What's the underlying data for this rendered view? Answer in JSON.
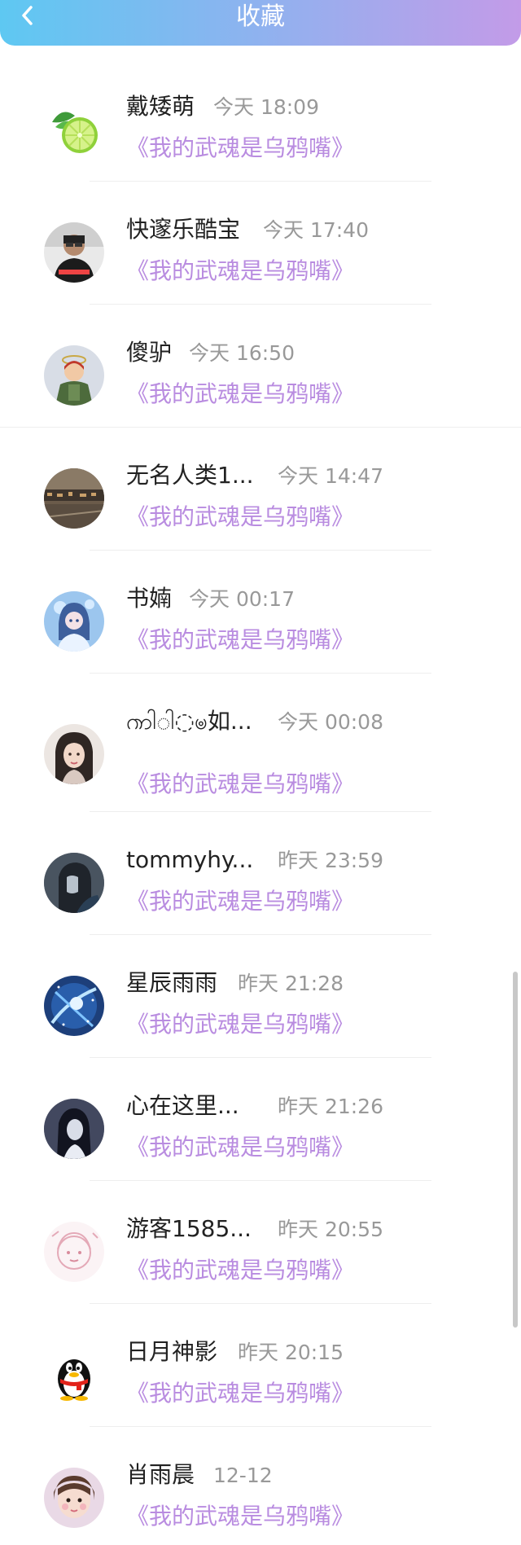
{
  "header": {
    "title": "收藏",
    "back_icon": "chevron-left-icon",
    "gradient_start": "#5ec8f2",
    "gradient_end": "#c39be8"
  },
  "colors": {
    "name": "#222222",
    "time": "#999999",
    "book_title": "#b98ce0"
  },
  "items": [
    {
      "name": "戴矮萌",
      "time": "今天 18:09",
      "book": "《我的武魂是乌鸦嘴》",
      "avatar": "lime-avatar"
    },
    {
      "name": "快邃乐酷宝",
      "time": "今天 17:40",
      "book": "《我的武魂是乌鸦嘴》",
      "avatar": "person-photo-avatar"
    },
    {
      "name": "傻驴",
      "time": "今天 16:50",
      "book": "《我的武魂是乌鸦嘴》",
      "avatar": "cartoon-avatar"
    },
    {
      "name": "无名人类1...",
      "time": "今天 14:47",
      "book": "《我的武魂是乌鸦嘴》",
      "avatar": "street-photo-avatar"
    },
    {
      "name": "书婻",
      "time": "今天 00:17",
      "book": "《我的武魂是乌鸦嘴》",
      "avatar": "anime-girl-avatar"
    },
    {
      "name": "ၮါ◌ါ◌ၑ如...",
      "time": "今天 00:08",
      "book": "《我的武魂是乌鸦嘴》",
      "avatar": "woman-portrait-avatar"
    },
    {
      "name": "tommyhy...",
      "time": "昨天 23:59",
      "book": "《我的武魂是乌鸦嘴》",
      "avatar": "dark-photo-avatar"
    },
    {
      "name": "星辰雨雨",
      "time": "昨天 21:28",
      "book": "《我的武魂是乌鸦嘴》",
      "avatar": "blue-fantasy-avatar"
    },
    {
      "name": "心在这里...",
      "time": "昨天 21:26",
      "book": "《我的武魂是乌鸦嘴》",
      "avatar": "dark-girl-avatar"
    },
    {
      "name": "游客1585...",
      "time": "昨天 20:55",
      "book": "《我的武魂是乌鸦嘴》",
      "avatar": "sketch-avatar"
    },
    {
      "name": "日月神影",
      "time": "昨天 20:15",
      "book": "《我的武魂是乌鸦嘴》",
      "avatar": "qq-penguin-avatar"
    },
    {
      "name": "肖雨晨",
      "time": "12-12",
      "book": "《我的武魂是乌鸦嘴》",
      "avatar": "child-photo-avatar"
    }
  ]
}
